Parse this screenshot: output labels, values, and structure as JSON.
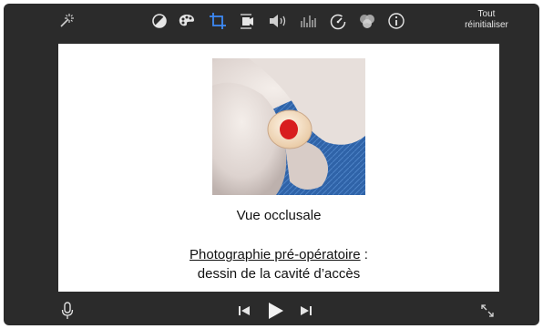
{
  "toolbar": {
    "tools": [
      {
        "name": "magic-wand-icon"
      },
      {
        "name": "color-balance-icon"
      },
      {
        "name": "color-palette-icon"
      },
      {
        "name": "crop-icon"
      },
      {
        "name": "stabilization-icon"
      },
      {
        "name": "volume-icon"
      },
      {
        "name": "equalizer-icon"
      },
      {
        "name": "speed-icon"
      },
      {
        "name": "filters-icon"
      },
      {
        "name": "info-icon"
      }
    ],
    "reset_line1": "Tout",
    "reset_line2": "réinitialiser"
  },
  "viewer": {
    "caption_view": "Vue occlusale",
    "caption_underlined": "Photographie pré-opératoire",
    "caption_colon": " :",
    "caption_line2": "dessin de la cavité d’accès"
  },
  "playback": {
    "controls": [
      "microphone-icon",
      "skip-back-icon",
      "play-icon",
      "skip-forward-icon",
      "fullscreen-icon"
    ]
  },
  "colors": {
    "app_background": "#2b2b2b",
    "active_tool": "#3d8af7",
    "icon": "#d9d9d9",
    "access_cavity_mark": "#d81e1e"
  }
}
